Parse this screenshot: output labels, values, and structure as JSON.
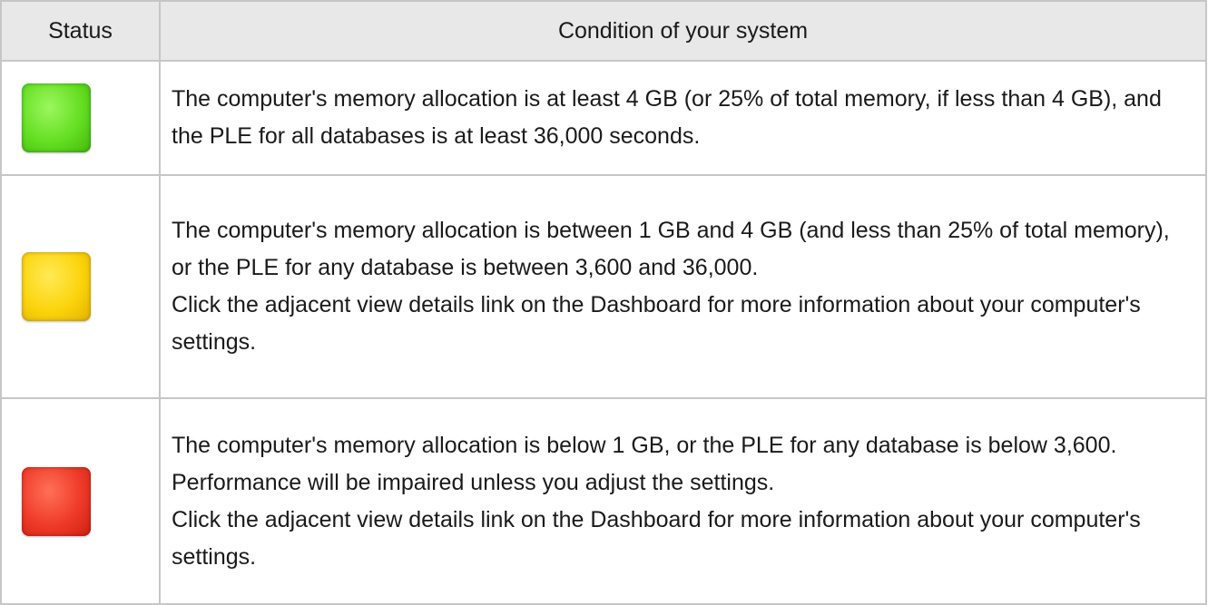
{
  "table": {
    "headers": {
      "status": "Status",
      "condition": "Condition of your system"
    },
    "rows": [
      {
        "status_color": "green",
        "status_hex": "#64df22",
        "paragraphs": [
          "The computer's memory allocation is at least 4 GB (or 25% of total memory, if less than 4 GB), and the PLE for all databases is at least 36,000 seconds."
        ]
      },
      {
        "status_color": "yellow",
        "status_hex": "#fbd40c",
        "paragraphs": [
          "The computer's memory allocation is between 1 GB and 4 GB (and less than 25% of total memory), or the PLE for any database is between 3,600 and 36,000.",
          "Click the adjacent view details link on the Dashboard for more information about your computer's settings."
        ]
      },
      {
        "status_color": "red",
        "status_hex": "#ef3a28",
        "paragraphs": [
          "The computer's memory allocation is below 1 GB, or the PLE for any database is below 3,600. Performance will be impaired unless you adjust the settings.",
          "Click the adjacent view details link on the Dashboard for more information about your computer's settings."
        ]
      }
    ]
  }
}
